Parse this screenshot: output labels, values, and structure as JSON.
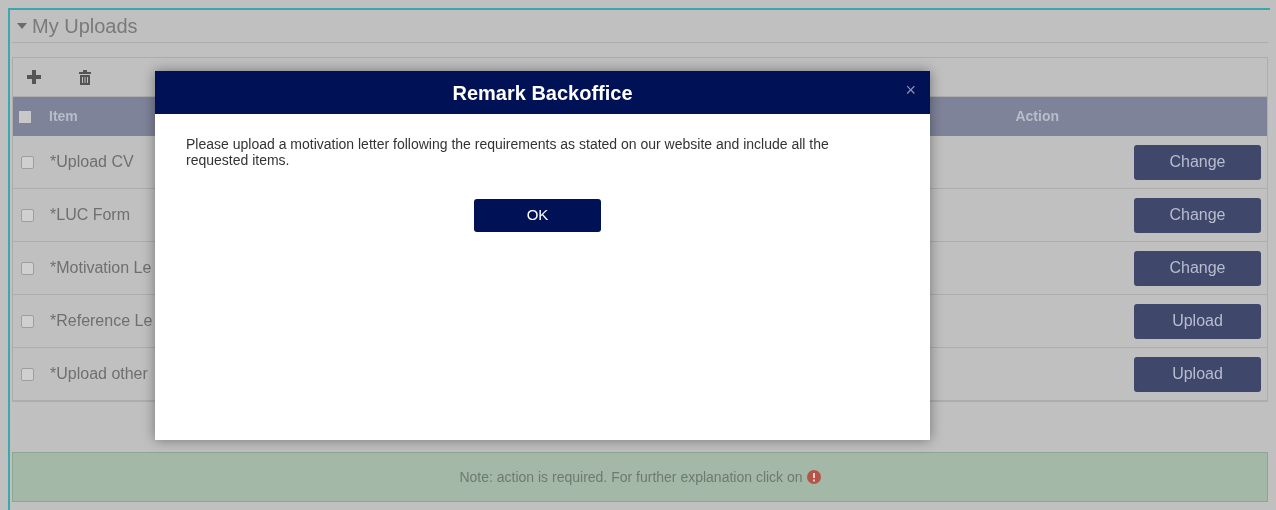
{
  "section": {
    "title": "My Uploads",
    "expanded": true
  },
  "table": {
    "header_checked": false,
    "columns": [
      "Item",
      "Action"
    ],
    "rows": [
      {
        "checked": false,
        "item": "*Upload CV",
        "action": "Change"
      },
      {
        "checked": false,
        "item": "*LUC Form",
        "action": "Change"
      },
      {
        "checked": false,
        "item": "*Motivation Le",
        "action": "Change"
      },
      {
        "checked": false,
        "item": "*Reference Le",
        "action": "Upload"
      },
      {
        "checked": false,
        "item": "*Upload other",
        "action": "Upload"
      }
    ]
  },
  "note": "Note: action is required. For further explanation click on",
  "dialog": {
    "title": "Remark Backoffice",
    "close": "×",
    "message": "Please upload a motivation letter following the requirements as stated on our website and include all the requested items.",
    "ok": "OK"
  }
}
